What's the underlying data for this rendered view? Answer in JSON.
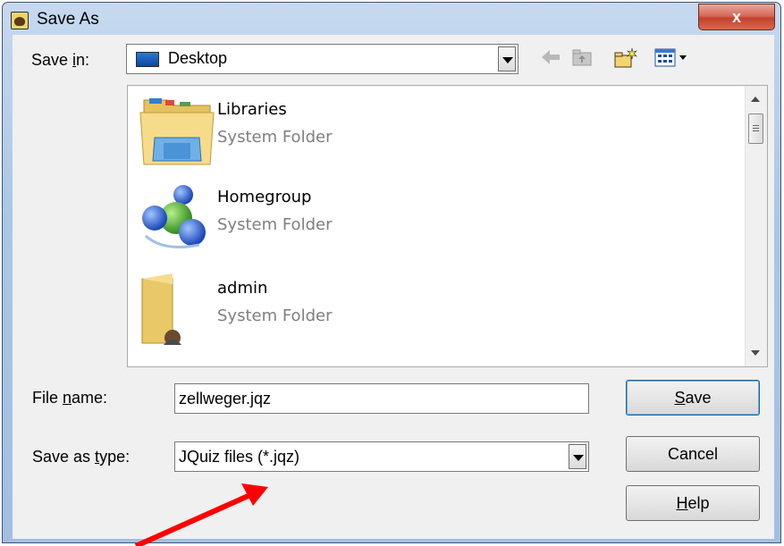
{
  "window": {
    "title": "Save As",
    "close_glyph": "x"
  },
  "toolbar": {
    "save_in_prefix": "Save ",
    "save_in_accel": "i",
    "save_in_suffix": "n:",
    "location": "Desktop",
    "back_icon": "back-arrow-icon",
    "up_icon": "up-one-level-icon",
    "new_folder_icon": "new-folder-icon",
    "views_icon": "view-menu-icon"
  },
  "files": [
    {
      "name": "Libraries",
      "type": "System Folder",
      "icon": "libraries-folder-icon"
    },
    {
      "name": "Homegroup",
      "type": "System Folder",
      "icon": "homegroup-icon"
    },
    {
      "name": "admin",
      "type": "System Folder",
      "icon": "user-folder-icon"
    }
  ],
  "form": {
    "filename_label_prefix": "File ",
    "filename_label_accel": "n",
    "filename_label_suffix": "ame:",
    "filename_value": "zellweger.jqz",
    "savetype_label_prefix": "Save as ",
    "savetype_label_accel": "t",
    "savetype_label_suffix": "ype:",
    "savetype_value": "JQuiz files (*.jqz)"
  },
  "buttons": {
    "save_accel": "S",
    "save_rest": "ave",
    "cancel": "Cancel",
    "help_accel": "H",
    "help_rest": "elp"
  },
  "colors": {
    "arrow": "#ff0000",
    "window_frame": "#a2bfe2",
    "close_button": "#c3412c"
  }
}
